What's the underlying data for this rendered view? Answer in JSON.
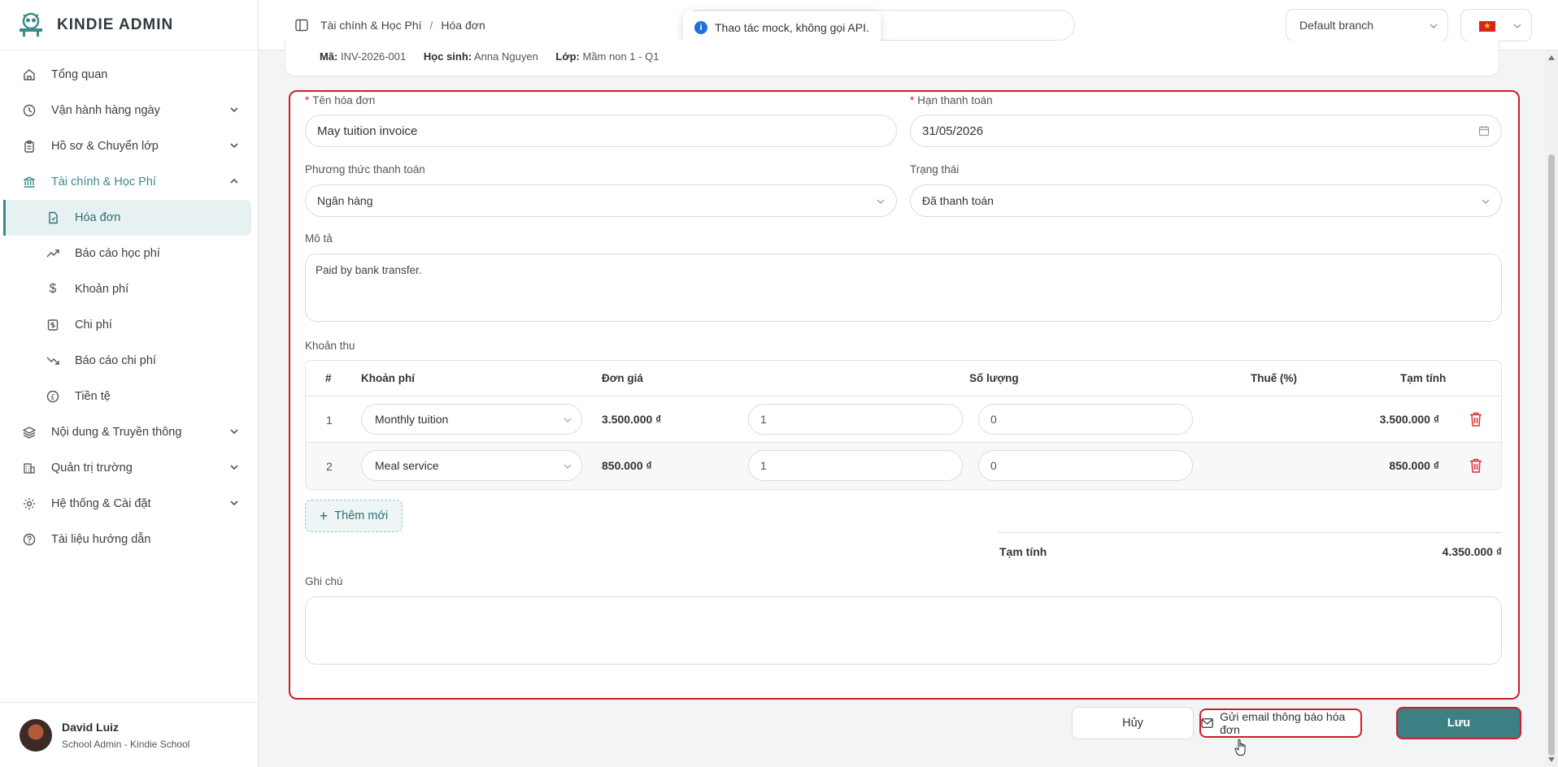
{
  "brand": {
    "name": "KINDIE ADMIN"
  },
  "sidebar": {
    "items": [
      {
        "label": "Tổng quan",
        "icon": "home-icon"
      },
      {
        "label": "Vận hành hàng ngày",
        "icon": "clock-icon",
        "expandable": true
      },
      {
        "label": "Hồ sơ & Chuyển lớp",
        "icon": "clipboard-icon",
        "expandable": true
      },
      {
        "label": "Tài chính & Học Phí",
        "icon": "bank-icon",
        "expandable": true,
        "expanded": true
      },
      {
        "label": "Nội dung & Truyền thông",
        "icon": "layers-icon",
        "expandable": true
      },
      {
        "label": "Quản trị trường",
        "icon": "building-icon",
        "expandable": true
      },
      {
        "label": "Hệ thống & Cài đặt",
        "icon": "gear-icon",
        "expandable": true
      },
      {
        "label": "Tài liệu hướng dẫn",
        "icon": "help-icon"
      }
    ],
    "finance_sub": [
      {
        "label": "Hóa đơn",
        "icon": "invoice-icon",
        "active": true
      },
      {
        "label": "Báo cáo học phí",
        "icon": "trending-up-icon"
      },
      {
        "label": "Khoản phí",
        "icon": "dollar-icon"
      },
      {
        "label": "Chi phí",
        "icon": "receipt-icon"
      },
      {
        "label": "Báo cáo chi phí",
        "icon": "trending-down-icon"
      },
      {
        "label": "Tiền tệ",
        "icon": "currency-icon"
      }
    ]
  },
  "user": {
    "name": "David Luiz",
    "role": "School Admin - Kindie School"
  },
  "header": {
    "breadcrumb": [
      "Tài chính & Học Phí",
      "Hóa đơn"
    ],
    "toast": "Thao tác mock, không gọi API.",
    "branch": "Default branch"
  },
  "invoice_meta": {
    "code_label": "Mã:",
    "code": "INV-2026-001",
    "student_label": "Học sinh:",
    "student": "Anna Nguyen",
    "class_label": "Lớp:",
    "class": "Mầm non 1 - Q1"
  },
  "form": {
    "name_label": "Tên hóa đơn",
    "name_value": "May tuition invoice",
    "due_label": "Hạn thanh toán",
    "due_value": "31/05/2026",
    "method_label": "Phương thức thanh toán",
    "method_value": "Ngân hàng",
    "status_label": "Trạng thái",
    "status_value": "Đã thanh toán",
    "desc_label": "Mô tả",
    "desc_value": "Paid by bank transfer.",
    "items_label": "Khoản thu",
    "note_label": "Ghi chú",
    "note_value": ""
  },
  "table": {
    "headers": {
      "idx": "#",
      "fee": "Khoản phí",
      "price": "Đơn giá",
      "qty": "Số lượng",
      "tax": "Thuế (%)",
      "subtotal": "Tạm tính"
    },
    "rows": [
      {
        "idx": "1",
        "fee": "Monthly tuition",
        "price": "3.500.000 ₫",
        "qty": "1",
        "tax": "0",
        "subtotal": "3.500.000 ₫"
      },
      {
        "idx": "2",
        "fee": "Meal service",
        "price": "850.000 ₫",
        "qty": "1",
        "tax": "0",
        "subtotal": "850.000 ₫"
      }
    ]
  },
  "add_button": "Thêm mới",
  "summary": {
    "label": "Tạm tính",
    "value": "4.350.000 ₫"
  },
  "actions": {
    "cancel": "Hủy",
    "email": "Gửi email thông báo hóa đơn",
    "save": "Lưu"
  },
  "colors": {
    "accent": "#3d7f82",
    "highlight": "#cc1f2c",
    "danger": "#d6323a"
  }
}
